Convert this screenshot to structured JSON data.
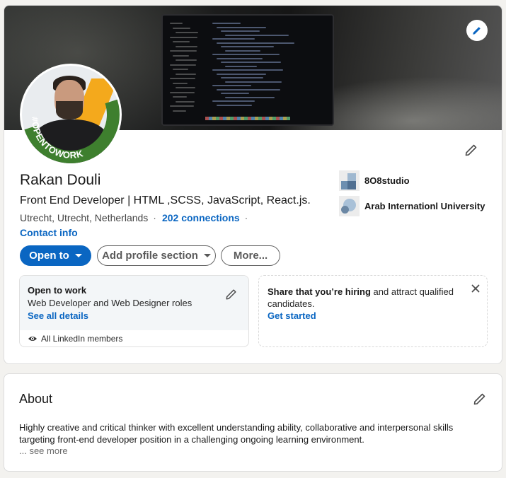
{
  "profile": {
    "name": "Rakan Douli",
    "headline": "Front End Developer | HTML ,SCSS, JavaScript, React.js.",
    "location": "Utrecht, Utrecht, Netherlands",
    "connections": "202 connections",
    "separator": "·",
    "contact_info": "Contact info",
    "badge_text": "#OPENTOWORK",
    "icons": {
      "banner_edit": "pencil-icon",
      "profile_edit": "pencil-icon",
      "dropdown": "caret-down-icon"
    }
  },
  "organizations": [
    {
      "name": "8O8studio",
      "icon": "company-logo"
    },
    {
      "name": "Arab Internationl University",
      "icon": "school-logo"
    }
  ],
  "actions": {
    "open_to": "Open to",
    "add_section": "Add profile section",
    "more": "More..."
  },
  "open_to_work": {
    "title": "Open to work",
    "roles": "Web Developer and Web Designer roles",
    "see_all": "See all details",
    "visibility": "All LinkedIn members",
    "icons": {
      "edit": "pencil-icon",
      "visibility": "eye-icon"
    }
  },
  "hiring": {
    "bold": "Share that you’re hiring",
    "rest": " and attract qualified candidates.",
    "cta": "Get started",
    "icons": {
      "close": "close-icon"
    }
  },
  "about": {
    "title": "About",
    "text": "Highly creative and critical thinker with excellent understanding ability, collaborative and interpersonal skills targeting front-end developer position in a challenging ongoing learning environment.",
    "see_more": "... see more",
    "icons": {
      "edit": "pencil-icon"
    }
  },
  "colors": {
    "link": "#0a66c2",
    "primary_button": "#0a66c2",
    "badge_green": "#3e7f2e",
    "page_bg": "#f3f2ef"
  }
}
